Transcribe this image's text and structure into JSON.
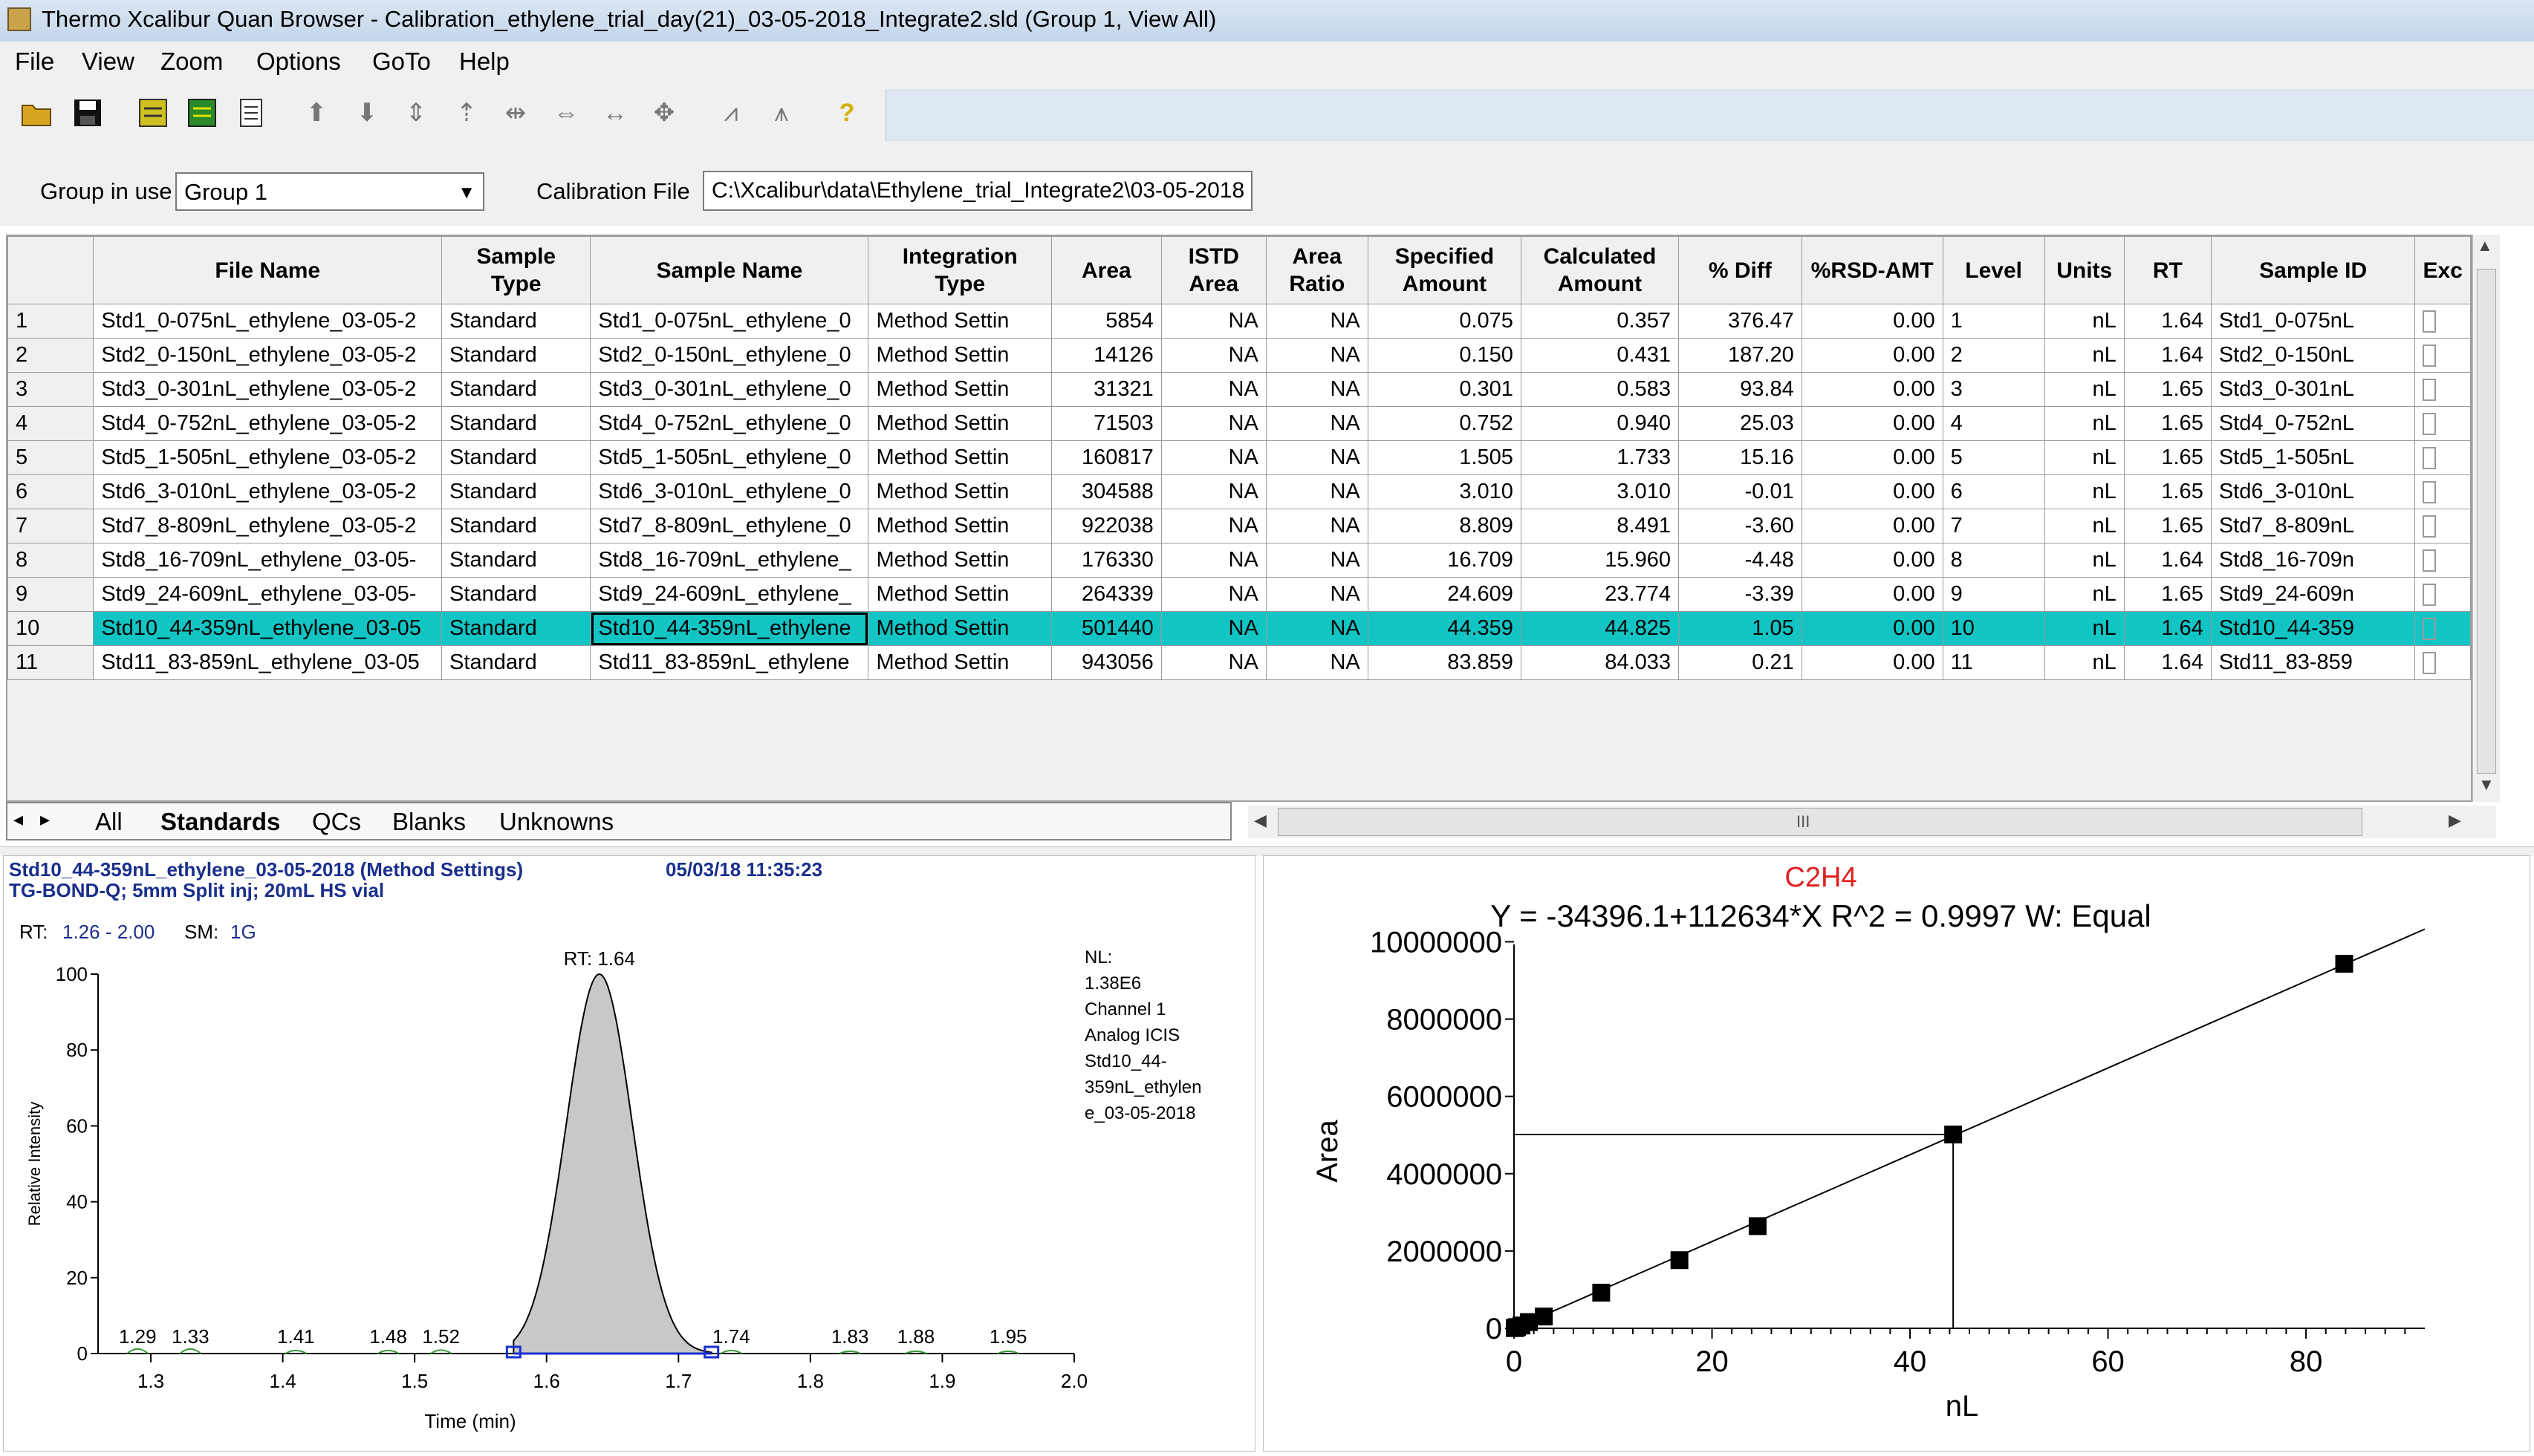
{
  "window": {
    "title": "Thermo Xcalibur Quan Browser - Calibration_ethylene_trial_day(21)_03-05-2018_Integrate2.sld (Group 1, View All)"
  },
  "menu": [
    "File",
    "View",
    "Zoom",
    "Options",
    "GoTo",
    "Help"
  ],
  "toolbar": {
    "icons": [
      "open-folder-icon",
      "save-icon",
      "report-icon",
      "green-report-icon",
      "document-icon",
      "up-arrow-icon",
      "down-arrow-icon",
      "updown-arrow-icon",
      "baseline-icon",
      "split-icon",
      "horizontal-arrows-icon",
      "double-arrow-icon",
      "move-icon",
      "peak-icon",
      "peak-split-icon",
      "help-icon"
    ],
    "colors": {
      "folder": "#d9a520",
      "save": "#111111",
      "report": "#cfc020",
      "green": "#2a8a2a",
      "help": "#d4b000"
    }
  },
  "group": {
    "label": "Group in use",
    "value": "Group 1"
  },
  "calibration": {
    "label": "Calibration File",
    "value": "C:\\Xcalibur\\data\\Ethylene_trial_Integrate2\\03-05-2018"
  },
  "table": {
    "headers": [
      "",
      "File Name",
      "Sample Type",
      "Sample Name",
      "Integration Type",
      "Area",
      "ISTD Area",
      "Area Ratio",
      "Specified Amount",
      "Calculated Amount",
      "% Diff",
      "%RSD-AMT",
      "Level",
      "Units",
      "RT",
      "Sample ID",
      "Exc"
    ],
    "rows": [
      [
        "1",
        "Std1_0-075nL_ethylene_03-05-2",
        "Standard",
        "Std1_0-075nL_ethylene_0",
        "Method Settin",
        "5854",
        "NA",
        "NA",
        "0.075",
        "0.357",
        "376.47",
        "0.00",
        "1",
        "nL",
        "1.64",
        "Std1_0-075nL"
      ],
      [
        "2",
        "Std2_0-150nL_ethylene_03-05-2",
        "Standard",
        "Std2_0-150nL_ethylene_0",
        "Method Settin",
        "14126",
        "NA",
        "NA",
        "0.150",
        "0.431",
        "187.20",
        "0.00",
        "2",
        "nL",
        "1.64",
        "Std2_0-150nL"
      ],
      [
        "3",
        "Std3_0-301nL_ethylene_03-05-2",
        "Standard",
        "Std3_0-301nL_ethylene_0",
        "Method Settin",
        "31321",
        "NA",
        "NA",
        "0.301",
        "0.583",
        "93.84",
        "0.00",
        "3",
        "nL",
        "1.65",
        "Std3_0-301nL"
      ],
      [
        "4",
        "Std4_0-752nL_ethylene_03-05-2",
        "Standard",
        "Std4_0-752nL_ethylene_0",
        "Method Settin",
        "71503",
        "NA",
        "NA",
        "0.752",
        "0.940",
        "25.03",
        "0.00",
        "4",
        "nL",
        "1.65",
        "Std4_0-752nL"
      ],
      [
        "5",
        "Std5_1-505nL_ethylene_03-05-2",
        "Standard",
        "Std5_1-505nL_ethylene_0",
        "Method Settin",
        "160817",
        "NA",
        "NA",
        "1.505",
        "1.733",
        "15.16",
        "0.00",
        "5",
        "nL",
        "1.65",
        "Std5_1-505nL"
      ],
      [
        "6",
        "Std6_3-010nL_ethylene_03-05-2",
        "Standard",
        "Std6_3-010nL_ethylene_0",
        "Method Settin",
        "304588",
        "NA",
        "NA",
        "3.010",
        "3.010",
        "-0.01",
        "0.00",
        "6",
        "nL",
        "1.65",
        "Std6_3-010nL"
      ],
      [
        "7",
        "Std7_8-809nL_ethylene_03-05-2",
        "Standard",
        "Std7_8-809nL_ethylene_0",
        "Method Settin",
        "922038",
        "NA",
        "NA",
        "8.809",
        "8.491",
        "-3.60",
        "0.00",
        "7",
        "nL",
        "1.65",
        "Std7_8-809nL"
      ],
      [
        "8",
        "Std8_16-709nL_ethylene_03-05-",
        "Standard",
        "Std8_16-709nL_ethylene_",
        "Method Settin",
        "176330",
        "NA",
        "NA",
        "16.709",
        "15.960",
        "-4.48",
        "0.00",
        "8",
        "nL",
        "1.64",
        "Std8_16-709n"
      ],
      [
        "9",
        "Std9_24-609nL_ethylene_03-05-",
        "Standard",
        "Std9_24-609nL_ethylene_",
        "Method Settin",
        "264339",
        "NA",
        "NA",
        "24.609",
        "23.774",
        "-3.39",
        "0.00",
        "9",
        "nL",
        "1.65",
        "Std9_24-609n"
      ],
      [
        "10",
        "Std10_44-359nL_ethylene_03-05",
        "Standard",
        "Std10_44-359nL_ethylene",
        "Method Settin",
        "501440",
        "NA",
        "NA",
        "44.359",
        "44.825",
        "1.05",
        "0.00",
        "10",
        "nL",
        "1.64",
        "Std10_44-359"
      ],
      [
        "11",
        "Std11_83-859nL_ethylene_03-05",
        "Standard",
        "Std11_83-859nL_ethylene",
        "Method Settin",
        "943056",
        "NA",
        "NA",
        "83.859",
        "84.033",
        "0.21",
        "0.00",
        "11",
        "nL",
        "1.64",
        "Std11_83-859"
      ]
    ],
    "selected_row": "10",
    "highlight_color": "#12c4c4"
  },
  "tabs": [
    "All",
    "Standards",
    "QCs",
    "Blanks",
    "Unknowns"
  ],
  "active_tab": "Standards",
  "scrollbar_grip": "III",
  "chromatogram": {
    "header1": "Std10_44-359nL_ethylene_03-05-2018  (Method Settings)",
    "timestamp": "05/03/18 11:35:23",
    "header2": "TG-BOND-Q; 5mm Split inj; 20mL HS vial",
    "rt_label": "RT:",
    "rt_range": "1.26 - 2.00",
    "sm_label": "SM:",
    "sm_value": "1G",
    "nl_info": [
      "NL:",
      "1.38E6",
      "Channel 1",
      "Analog  ICIS",
      "Std10_44-",
      "359nL_ethylen",
      "e_03-05-2018"
    ],
    "apex_label": "RT: 1.64",
    "xlabel": "Time (min)",
    "ylabel": "Relative Intensity",
    "peak_labels": [
      "1.29",
      "1.33",
      "1.41",
      "1.48",
      "1.52",
      "1.74",
      "1.83",
      "1.88",
      "1.95"
    ],
    "fill_color": "#c8c8c8",
    "marker_color": "#1a2fd0"
  },
  "chart_data": [
    {
      "type": "area",
      "title": "",
      "xlabel": "Time (min)",
      "ylabel": "Relative Intensity",
      "xlim": [
        1.26,
        2.0
      ],
      "ylim": [
        0,
        100
      ],
      "x_ticks": [
        "1.3",
        "1.4",
        "1.5",
        "1.6",
        "1.7",
        "1.8",
        "1.9",
        "2.0"
      ],
      "y_ticks": [
        "0",
        "20",
        "40",
        "60",
        "80",
        "100"
      ],
      "peak": {
        "rt": 1.64,
        "start": 1.575,
        "end": 1.725,
        "height": 100
      },
      "minor_peaks": [
        {
          "rt": 1.29,
          "height": 1.2
        },
        {
          "rt": 1.33,
          "height": 1.2
        },
        {
          "rt": 1.41,
          "height": 0.8
        },
        {
          "rt": 1.48,
          "height": 0.8
        },
        {
          "rt": 1.52,
          "height": 0.9
        },
        {
          "rt": 1.74,
          "height": 0.8
        },
        {
          "rt": 1.83,
          "height": 0.6
        },
        {
          "rt": 1.88,
          "height": 0.6
        },
        {
          "rt": 1.95,
          "height": 0.6
        }
      ]
    },
    {
      "type": "scatter",
      "title": "C2H4",
      "equation": "Y = -34396.1+112634*X   R^2 = 0.9997   W: Equal",
      "xlabel": "nL",
      "ylabel": "Area",
      "xlim": [
        0,
        92
      ],
      "ylim": [
        0,
        10700000
      ],
      "x_ticks": [
        "0",
        "20",
        "40",
        "60",
        "80"
      ],
      "y_ticks": [
        "0",
        "2000000",
        "4000000",
        "6000000",
        "8000000",
        "10000000"
      ],
      "fit": {
        "intercept": -34396.1,
        "slope": 112634
      },
      "x": [
        0.075,
        0.15,
        0.301,
        0.752,
        1.505,
        3.01,
        8.809,
        16.709,
        24.609,
        44.359,
        83.859
      ],
      "y": [
        5854,
        14126,
        31321,
        71503,
        160817,
        304588,
        922038,
        1763300,
        2643390,
        5014400,
        9430560
      ],
      "selected_point": {
        "x": 44.359,
        "y": 5014400
      },
      "title_color": "#e02020"
    }
  ]
}
